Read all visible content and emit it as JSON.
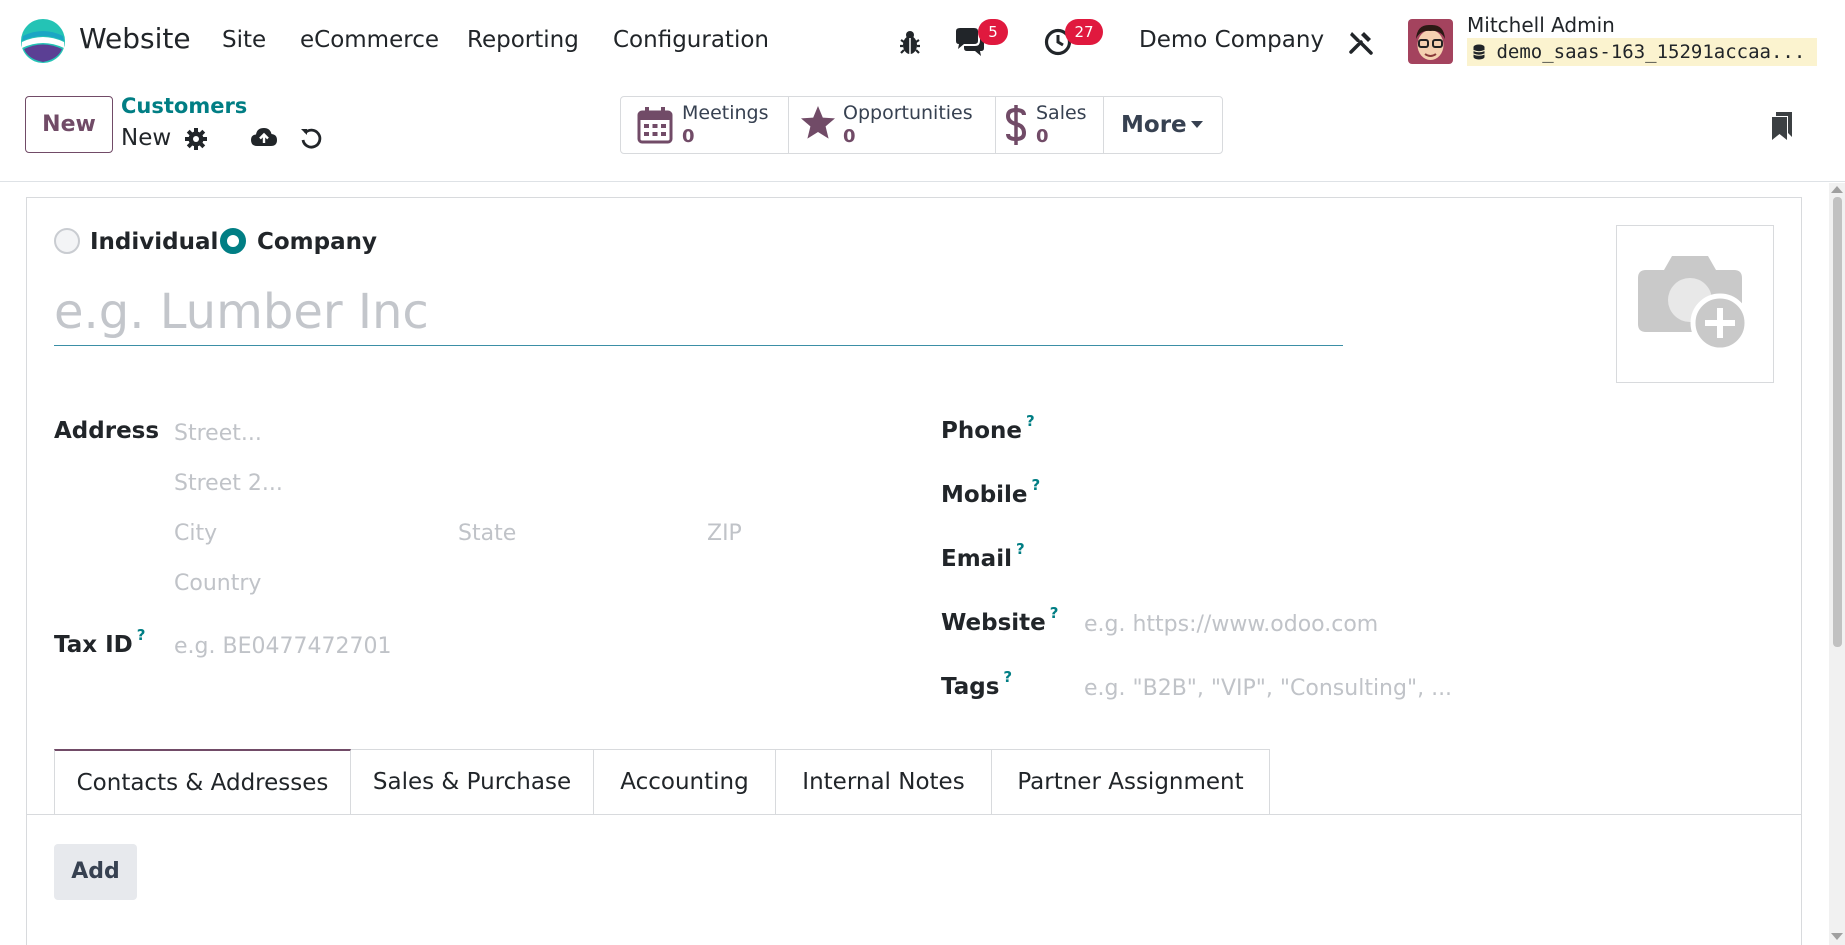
{
  "navbar": {
    "app_name": "Website",
    "menus": [
      "Site",
      "eCommerce",
      "Reporting",
      "Configuration"
    ],
    "messages_count": "5",
    "activities_count": "27",
    "company": "Demo Company",
    "user_name": "Mitchell Admin",
    "database": "demo_saas-163_15291accaa..."
  },
  "control": {
    "new_label": "New",
    "breadcrumb_parent": "Customers",
    "breadcrumb_current": "New",
    "smart_buttons": [
      {
        "label": "Meetings",
        "value": "0"
      },
      {
        "label": "Opportunities",
        "value": "0"
      },
      {
        "label": "Sales",
        "value": "0"
      }
    ],
    "more_label": "More"
  },
  "form": {
    "type_individual": "Individual",
    "type_company": "Company",
    "selected_type": "Company",
    "name_placeholder": "e.g. Lumber Inc",
    "address_label": "Address",
    "street_placeholder": "Street...",
    "street2_placeholder": "Street 2...",
    "city_placeholder": "City",
    "state_placeholder": "State",
    "zip_placeholder": "ZIP",
    "country_placeholder": "Country",
    "taxid_label": "Tax ID",
    "taxid_placeholder": "e.g. BE0477472701",
    "phone_label": "Phone",
    "mobile_label": "Mobile",
    "email_label": "Email",
    "website_label": "Website",
    "website_placeholder": "e.g. https://www.odoo.com",
    "tags_label": "Tags",
    "tags_placeholder": "e.g. \"B2B\", \"VIP\", \"Consulting\", ...",
    "help_mark": "?"
  },
  "notebook": {
    "tabs": [
      "Contacts & Addresses",
      "Sales & Purchase",
      "Accounting",
      "Internal Notes",
      "Partner Assignment"
    ],
    "active_tab": "Contacts & Addresses",
    "add_label": "Add"
  },
  "colors": {
    "brand": "#714b67",
    "accent": "#017e84",
    "badge": "#e0193e"
  }
}
